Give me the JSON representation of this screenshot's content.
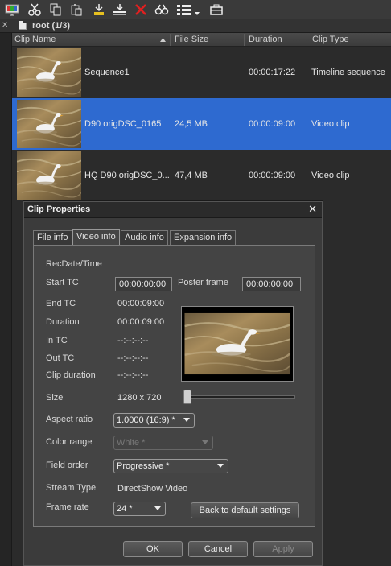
{
  "toolbar": {
    "buttons": [
      "clip-properties-icon",
      "cut-icon",
      "copy-icon",
      "paste-icon",
      "add-to-timeline-icon",
      "insert-icon",
      "delete-icon",
      "search-icon",
      "view-mode-icon",
      "folder-icon"
    ]
  },
  "root": {
    "title": "root (1/3)"
  },
  "columns": {
    "clip_name": "Clip Name",
    "file_size": "File Size",
    "duration": "Duration",
    "clip_type": "Clip Type"
  },
  "clips": [
    {
      "name": "Sequence1",
      "size": "",
      "duration": "00:00:17:22",
      "type": "Timeline sequence"
    },
    {
      "name": "D90 origDSC_0165",
      "size": "24,5 MB",
      "duration": "00:00:09:00",
      "type": "Video clip"
    },
    {
      "name": "HQ D90 origDSC_0...",
      "size": "47,4 MB",
      "duration": "00:00:09:00",
      "type": "Video clip"
    }
  ],
  "dialog": {
    "title": "Clip Properties",
    "close": "✕",
    "tabs": [
      "File info",
      "Video info",
      "Audio info",
      "Expansion info"
    ],
    "recdate_label": "RecDate/Time",
    "start_tc_label": "Start TC",
    "start_tc_value": "00:00:00:00",
    "poster_label": "Poster frame",
    "poster_value": "00:00:00:00",
    "end_tc_label": "End TC",
    "end_tc_value": "00:00:09:00",
    "duration_label": "Duration",
    "duration_value": "00:00:09:00",
    "in_tc_label": "In TC",
    "in_tc_value": "--:--:--:--",
    "out_tc_label": "Out TC",
    "out_tc_value": "--:--:--:--",
    "clip_duration_label": "Clip duration",
    "clip_duration_value": "--:--:--:--",
    "size_label": "Size",
    "size_value": "1280 x 720",
    "aspect_label": "Aspect ratio",
    "aspect_value": "1.0000 (16:9) *",
    "color_range_label": "Color range",
    "color_range_value": "White *",
    "field_order_label": "Field order",
    "field_order_value": "Progressive *",
    "stream_type_label": "Stream Type",
    "stream_type_value": "DirectShow Video",
    "frame_rate_label": "Frame rate",
    "frame_rate_value": "24 *",
    "back_default": "Back to default settings",
    "ok": "OK",
    "cancel": "Cancel",
    "apply": "Apply"
  },
  "colors": {
    "selection": "#2e6ad0",
    "background": "#2b2b2b",
    "dialog": "#3b3b3b"
  }
}
